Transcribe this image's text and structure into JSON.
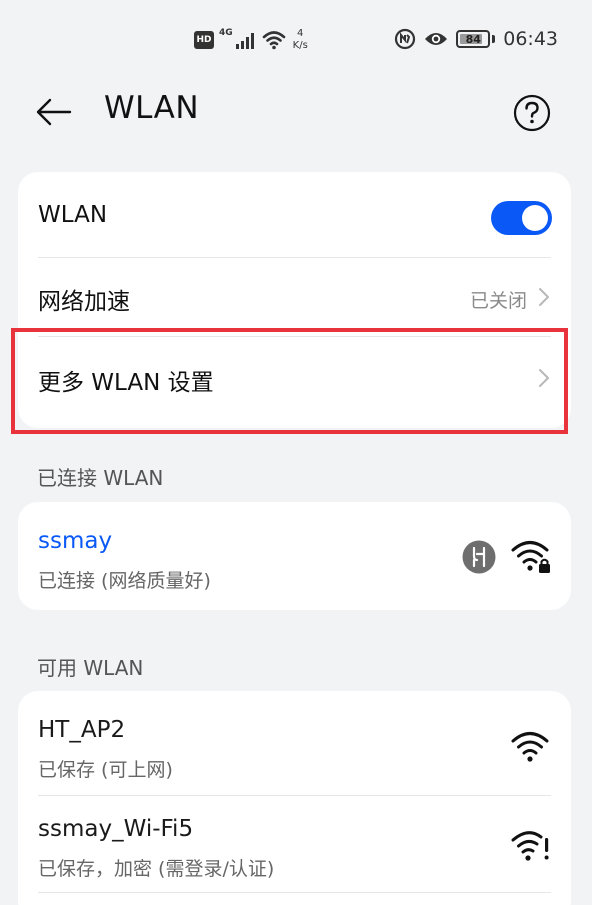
{
  "status_bar": {
    "hd_badge": "HD",
    "network_type": "4G",
    "speed_value": "4",
    "speed_unit": "K/s",
    "battery_level": "84",
    "battery_fraction": 0.84,
    "time": "06:43",
    "icons": [
      "hd-icon",
      "signal-icon",
      "wifi-status-icon",
      "nfc-icon",
      "eye-icon",
      "battery-icon"
    ]
  },
  "header": {
    "title": "WLAN",
    "back_icon": "back-arrow-icon",
    "help_icon": "help-icon"
  },
  "settings": {
    "wlan_label": "WLAN",
    "wlan_enabled": true,
    "accel_label": "网络加速",
    "accel_value": "已关闭",
    "more_label": "更多 WLAN 设置"
  },
  "connected": {
    "section_title": "已连接 WLAN",
    "name": "ssmay",
    "status": "已连接 (网络质量好)",
    "badge_icon": "hilink-icon",
    "wifi_icon": "wifi-lock-icon"
  },
  "available": {
    "section_title": "可用 WLAN",
    "networks": [
      {
        "name": "HT_AP2",
        "status": "已保存 (可上网)",
        "icon": "wifi-icon"
      },
      {
        "name": "ssmay_Wi-Fi5",
        "status": "已保存，加密 (需登录/认证)",
        "icon": "wifi-alert-icon"
      }
    ]
  },
  "colors": {
    "accent": "#0a59f7",
    "highlight": "#e8323c",
    "background": "#f1f3f5"
  }
}
